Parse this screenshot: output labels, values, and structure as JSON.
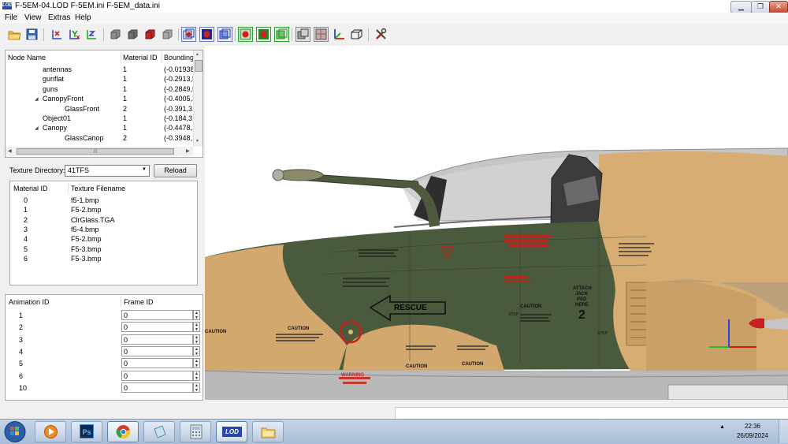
{
  "window": {
    "title": "F-5EM-04.LOD  F-5EM.ini  F-5EM_data.ini",
    "app_icon_text": "LOD",
    "controls": [
      "minimize",
      "restore",
      "close"
    ]
  },
  "menu": [
    "File",
    "View",
    "Extras",
    "Help"
  ],
  "toolbar": {
    "icons": [
      "open-folder-icon",
      "save-icon",
      "axis-x-rotate-icon",
      "axis-y-rotate-icon",
      "axis-z-rotate-icon",
      "cube-solid-icon",
      "cube-dark-icon",
      "cube-red-icon",
      "cube-gray-icon",
      "wire-box-blue-icon",
      "wire-box-red-icon",
      "wire-box-outline-icon",
      "box-red-green-icon",
      "box-green-icon",
      "box-green-alt-icon",
      "layers-icon",
      "texture-icon",
      "axes-icon",
      "bounding-box-icon",
      "tools-icon"
    ]
  },
  "node_tree": {
    "columns": [
      "Node Name",
      "Material ID",
      "Bounding"
    ],
    "rows": [
      {
        "name": "antennas",
        "material": "1",
        "bounding": "(-0.01938,",
        "indent": 1,
        "expander": ""
      },
      {
        "name": "gunflat",
        "material": "1",
        "bounding": "(-0.2913,5",
        "indent": 1,
        "expander": ""
      },
      {
        "name": "guns",
        "material": "1",
        "bounding": "(-0.2849,5",
        "indent": 1,
        "expander": ""
      },
      {
        "name": "CanopyFront",
        "material": "1",
        "bounding": "(-0.4005,3",
        "indent": 1,
        "expander": "◢"
      },
      {
        "name": "GlassFront",
        "material": "2",
        "bounding": "(-0.391,3.4",
        "indent": 2,
        "expander": ""
      },
      {
        "name": "Object01",
        "material": "1",
        "bounding": "(-0.184,3.2",
        "indent": 1,
        "expander": ""
      },
      {
        "name": "Canopy",
        "material": "1",
        "bounding": "(-0.4478,1",
        "indent": 1,
        "expander": "◢"
      },
      {
        "name": "GlassCanop",
        "material": "2",
        "bounding": "(-0.3948,1",
        "indent": 2,
        "expander": ""
      }
    ]
  },
  "texture": {
    "directory_label": "Texture Directory:",
    "directory_value": "41TFS",
    "reload_label": "Reload",
    "columns": [
      "Material ID",
      "Texture Filename"
    ],
    "rows": [
      {
        "id": "0",
        "file": "f5-1.bmp"
      },
      {
        "id": "1",
        "file": "F5-2.bmp"
      },
      {
        "id": "2",
        "file": "ClrGlass.TGA"
      },
      {
        "id": "3",
        "file": "f5-4.bmp"
      },
      {
        "id": "4",
        "file": "F5-2.bmp"
      },
      {
        "id": "5",
        "file": "F5-3.bmp"
      },
      {
        "id": "6",
        "file": "F5-3.bmp"
      }
    ]
  },
  "animation": {
    "columns": [
      "Animation ID",
      "Frame ID"
    ],
    "rows": [
      {
        "id": "1",
        "frame": "0"
      },
      {
        "id": "2",
        "frame": "0"
      },
      {
        "id": "3",
        "frame": "0"
      },
      {
        "id": "4",
        "frame": "0"
      },
      {
        "id": "5",
        "frame": "0"
      },
      {
        "id": "6",
        "frame": "0"
      },
      {
        "id": "10",
        "frame": "0"
      }
    ]
  },
  "viewport": {
    "decals": {
      "rescue": "RESCUE",
      "caution": "CAUTION",
      "warning": "WARNING",
      "step": "STEP",
      "attach": "ATTACH",
      "jack": "JACK",
      "pad": "PAD",
      "here": "HERE",
      "number": "2"
    },
    "colors": {
      "camo_green": "#4a5a3c",
      "camo_tan": "#d2a86e",
      "canopy": "#b8b8b8",
      "red_decal": "#c8201a"
    }
  },
  "taskbar": {
    "apps": [
      "start-orb",
      "media-player-icon",
      "photoshop-icon",
      "chrome-icon",
      "file-icon",
      "calculator-icon",
      "lod-editor-icon",
      "file-manager-icon"
    ],
    "ps_label": "Ps",
    "lod_label": "LOD",
    "time": "22:36",
    "date": "26/09/2024"
  }
}
